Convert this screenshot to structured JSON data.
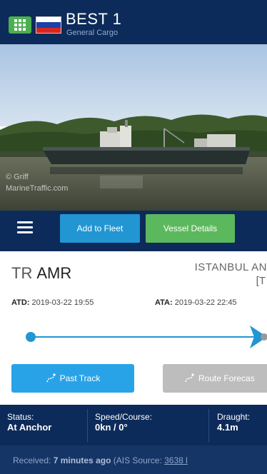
{
  "header": {
    "vessel_name": "BEST 1",
    "vessel_type": "General Cargo",
    "flag_colors": [
      "#ffffff",
      "#1c3fa8",
      "#d8261e"
    ]
  },
  "photo": {
    "credit_line1": "© Griff",
    "credit_line2": "MarineTraffic.com"
  },
  "actions": {
    "add_to_fleet": "Add to Fleet",
    "vessel_details": "Vessel Details"
  },
  "voyage": {
    "from_country": "TR",
    "from_port": "AMR",
    "to_port": "ISTANBUL AN",
    "to_bracket": "[T",
    "atd_label": "ATD:",
    "atd_value": "2019-03-22 19:55",
    "ata_label": "ATA:",
    "ata_value": "2019-03-22 22:45",
    "past_track": "Past Track",
    "route_forecast": "Route Forecas"
  },
  "status": {
    "status_label": "Status:",
    "status_value": "At Anchor",
    "speed_label": "Speed/Course:",
    "speed_value": "0kn / 0°",
    "draught_label": "Draught:",
    "draught_value": "4.1m"
  },
  "received": {
    "prefix": "Received:",
    "age": "7 minutes ago",
    "source_label": "(AIS Source:",
    "source_id": "3638 l"
  },
  "colors": {
    "navy": "#0d2b5a",
    "blue": "#2196d3",
    "green": "#5cb85c",
    "gray": "#bdbdbd"
  },
  "icons": {
    "grid": "grid-icon",
    "menu": "menu-icon",
    "track": "track-icon"
  }
}
